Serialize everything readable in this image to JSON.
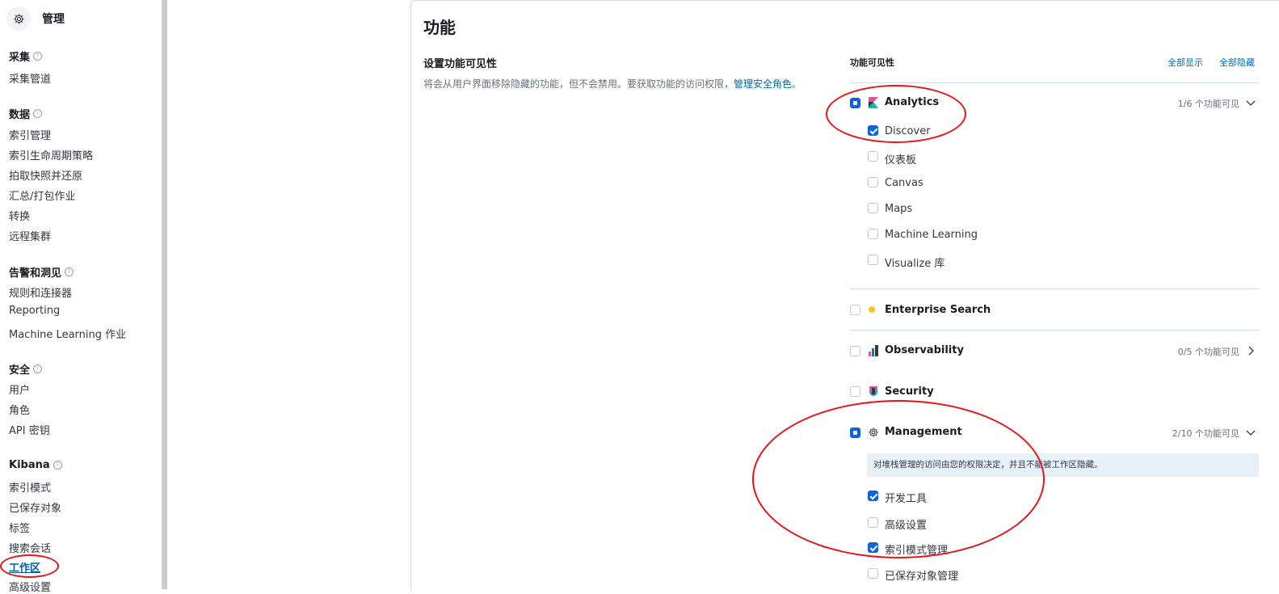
{
  "sidebar": {
    "title": "管理",
    "groups": [
      {
        "title": "采集",
        "items": [
          "采集管道"
        ]
      },
      {
        "title": "数据",
        "items": [
          "索引管理",
          "索引生命周期策略",
          "拍取快照并还原",
          "汇总/打包作业",
          "转换",
          "远程集群"
        ]
      },
      {
        "title": "告警和洞见",
        "items": [
          "规则和连接器",
          "Reporting",
          "Machine Learning 作业"
        ]
      },
      {
        "title": "安全",
        "items": [
          "用户",
          "角色",
          "API 密钥"
        ]
      },
      {
        "title": "Kibana",
        "items": [
          "索引模式",
          "已保存对象",
          "标签",
          "搜索会话",
          "工作区",
          "高级设置"
        ]
      }
    ],
    "active_item": "工作区"
  },
  "main": {
    "title": "功能",
    "desc_title": "设置功能可见性",
    "desc_text": "将会从用户界面移除隐藏的功能，但不会禁用。要获取功能的访问权限，",
    "desc_link": "管理安全角色",
    "desc_end": "。",
    "visibility_title": "功能可见性",
    "show_all": "全部显示",
    "hide_all": "全部隐藏"
  },
  "features": {
    "analytics": {
      "label": "Analytics",
      "count": "1/6 个功能可见",
      "state": "indeterminate",
      "children": [
        {
          "label": "Discover",
          "checked": true
        },
        {
          "label": "仪表板",
          "checked": false
        },
        {
          "label": "Canvas",
          "checked": false
        },
        {
          "label": "Maps",
          "checked": false
        },
        {
          "label": "Machine Learning",
          "checked": false
        },
        {
          "label": "Visualize 库",
          "checked": false
        }
      ]
    },
    "enterprise_search": {
      "label": "Enterprise Search",
      "state": "unchecked"
    },
    "observability": {
      "label": "Observability",
      "count": "0/5 个功能可见",
      "state": "unchecked"
    },
    "security": {
      "label": "Security",
      "state": "unchecked"
    },
    "management": {
      "label": "Management",
      "count": "2/10 个功能可见",
      "state": "indeterminate",
      "notice": "对堆栈管理的访问由您的权限决定，并且不能被工作区隐藏。",
      "children": [
        {
          "label": "开发工具",
          "checked": true
        },
        {
          "label": "高级设置",
          "checked": false
        },
        {
          "label": "索引模式管理",
          "checked": true
        },
        {
          "label": "已保存对象管理",
          "checked": false
        }
      ]
    }
  },
  "colors": {
    "accent": "#0b64dd",
    "link": "#006bb8",
    "annotation": "#e8141a"
  },
  "icons": {
    "sidebar_header": "gear-icon",
    "analytics": "kibana-logo-icon",
    "enterprise_search": "enterprise-search-logo-icon",
    "observability": "observability-logo-icon",
    "security": "security-logo-icon",
    "management": "gear-icon"
  }
}
